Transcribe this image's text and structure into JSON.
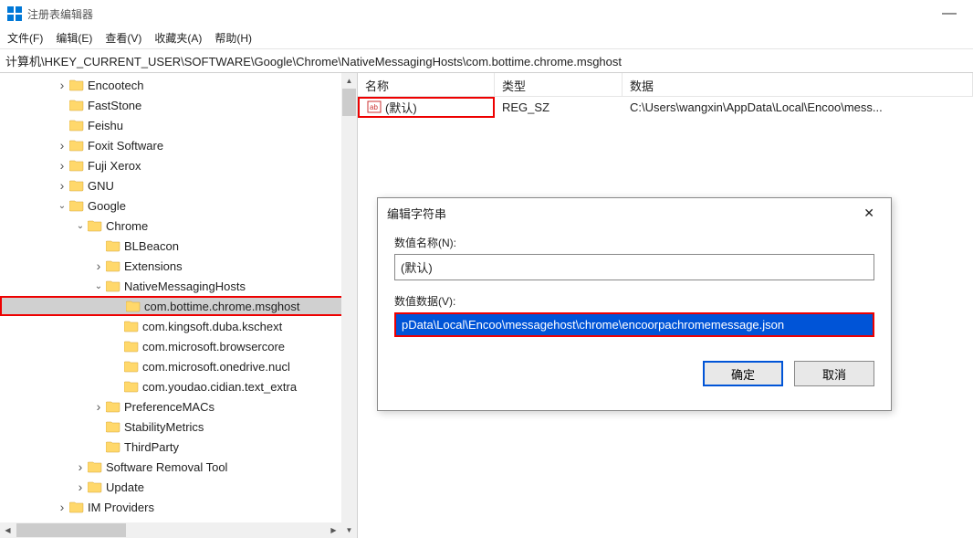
{
  "app": {
    "title": "注册表编辑器"
  },
  "menu": {
    "file": "文件(F)",
    "edit": "编辑(E)",
    "view": "查看(V)",
    "favorites": "收藏夹(A)",
    "help": "帮助(H)"
  },
  "address": "计算机\\HKEY_CURRENT_USER\\SOFTWARE\\Google\\Chrome\\NativeMessagingHosts\\com.bottime.chrome.msghost",
  "tree": {
    "items": [
      {
        "indent": 60,
        "chev": "right",
        "label": "Encootech"
      },
      {
        "indent": 60,
        "chev": "none",
        "label": "FastStone"
      },
      {
        "indent": 60,
        "chev": "none",
        "label": "Feishu"
      },
      {
        "indent": 60,
        "chev": "right",
        "label": "Foxit Software"
      },
      {
        "indent": 60,
        "chev": "right",
        "label": "Fuji Xerox"
      },
      {
        "indent": 60,
        "chev": "right",
        "label": "GNU"
      },
      {
        "indent": 60,
        "chev": "down",
        "label": "Google"
      },
      {
        "indent": 80,
        "chev": "down",
        "label": "Chrome"
      },
      {
        "indent": 100,
        "chev": "none",
        "label": "BLBeacon"
      },
      {
        "indent": 100,
        "chev": "right",
        "label": "Extensions"
      },
      {
        "indent": 100,
        "chev": "down",
        "label": "NativeMessagingHosts"
      },
      {
        "indent": 120,
        "chev": "none",
        "label": "com.bottime.chrome.msghost",
        "selected": true,
        "highlighted": true
      },
      {
        "indent": 120,
        "chev": "none",
        "label": "com.kingsoft.duba.kschext"
      },
      {
        "indent": 120,
        "chev": "none",
        "label": "com.microsoft.browsercore"
      },
      {
        "indent": 120,
        "chev": "none",
        "label": "com.microsoft.onedrive.nucl"
      },
      {
        "indent": 120,
        "chev": "none",
        "label": "com.youdao.cidian.text_extra"
      },
      {
        "indent": 100,
        "chev": "right",
        "label": "PreferenceMACs"
      },
      {
        "indent": 100,
        "chev": "none",
        "label": "StabilityMetrics"
      },
      {
        "indent": 100,
        "chev": "none",
        "label": "ThirdParty"
      },
      {
        "indent": 80,
        "chev": "right",
        "label": "Software Removal Tool"
      },
      {
        "indent": 80,
        "chev": "right",
        "label": "Update"
      },
      {
        "indent": 60,
        "chev": "right",
        "label": "IM Providers"
      }
    ]
  },
  "list": {
    "headers": {
      "name": "名称",
      "type": "类型",
      "data": "数据"
    },
    "rows": [
      {
        "name": "(默认)",
        "type": "REG_SZ",
        "data": "C:\\Users\\wangxin\\AppData\\Local\\Encoo\\mess..."
      }
    ]
  },
  "dialog": {
    "title": "编辑字符串",
    "name_label": "数值名称(N):",
    "name_value": "(默认)",
    "data_label": "数值数据(V):",
    "data_value": "pData\\Local\\Encoo\\messagehost\\chrome\\encoorpachromemessage.json",
    "ok": "确定",
    "cancel": "取消"
  }
}
